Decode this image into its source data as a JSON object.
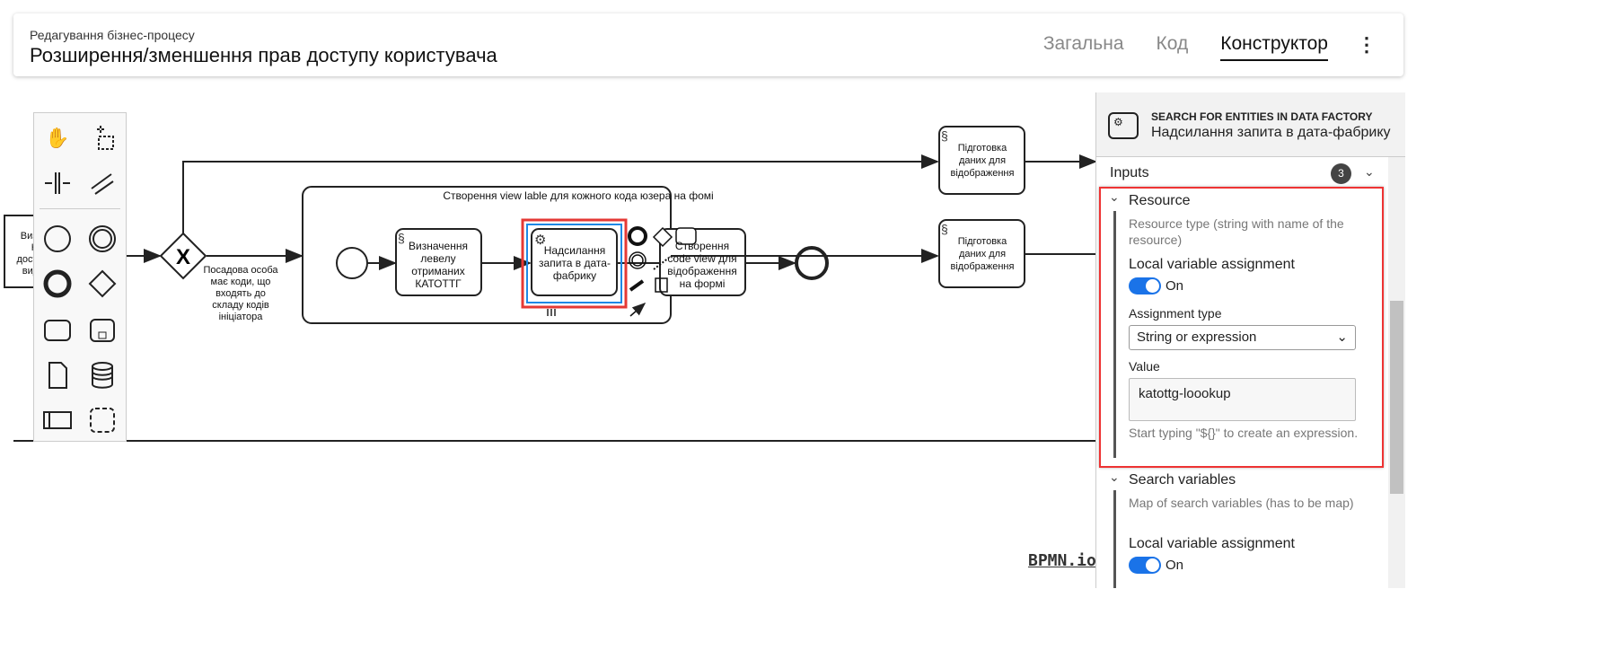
{
  "header": {
    "subtitle": "Редагування бізнес-процесу",
    "title": "Розширення/зменшення прав доступу користувача",
    "tabs": [
      {
        "label": "Загальна",
        "active": false
      },
      {
        "label": "Код",
        "active": false
      },
      {
        "label": "Конструктор",
        "active": true
      }
    ],
    "more_icon": "⋮"
  },
  "diagram": {
    "left_task": [
      "Виз",
      "К",
      "дост",
      "вид"
    ],
    "gateway_label": [
      "Посадова особа",
      "має коди, що",
      "входять до",
      "складу кодів",
      "ініціатора"
    ],
    "subprocess_label": "Створення view lable для кожного кода юзера на фомі",
    "task1": [
      "Визначення",
      "левелу",
      "отриманих",
      "КАТОТТГ"
    ],
    "task2": [
      "Надсилання",
      "запита в дата-",
      "фабрику"
    ],
    "task3": [
      "Створення",
      "code view для",
      "відображення",
      "на формі"
    ],
    "task4": [
      "Підготовка",
      "даних для",
      "відображення"
    ],
    "task5": [
      "Підготовка",
      "даних для",
      "відображення"
    ],
    "watermark": "BPMN.io",
    "selection_color": "#1e88e5",
    "highlight_color": "#e53935"
  },
  "panel": {
    "type": "SEARCH FOR ENTITIES IN DATA FACTORY",
    "name": "Надсилання запита в дата-фабрику",
    "inputs_label": "Inputs",
    "inputs_count": "3",
    "resource": {
      "title": "Resource",
      "description": "Resource type (string with name of the resource)",
      "local_var_label": "Local variable assignment",
      "toggle": "On",
      "assign_type_label": "Assignment type",
      "assign_type_value": "String or expression",
      "value_label": "Value",
      "value": "katottg-loookup",
      "hint": "Start typing \"${}\" to create an expression."
    },
    "search": {
      "title": "Search variables",
      "description": "Map of search variables (has to be map)",
      "local_var_label": "Local variable assignment",
      "toggle": "On"
    }
  }
}
